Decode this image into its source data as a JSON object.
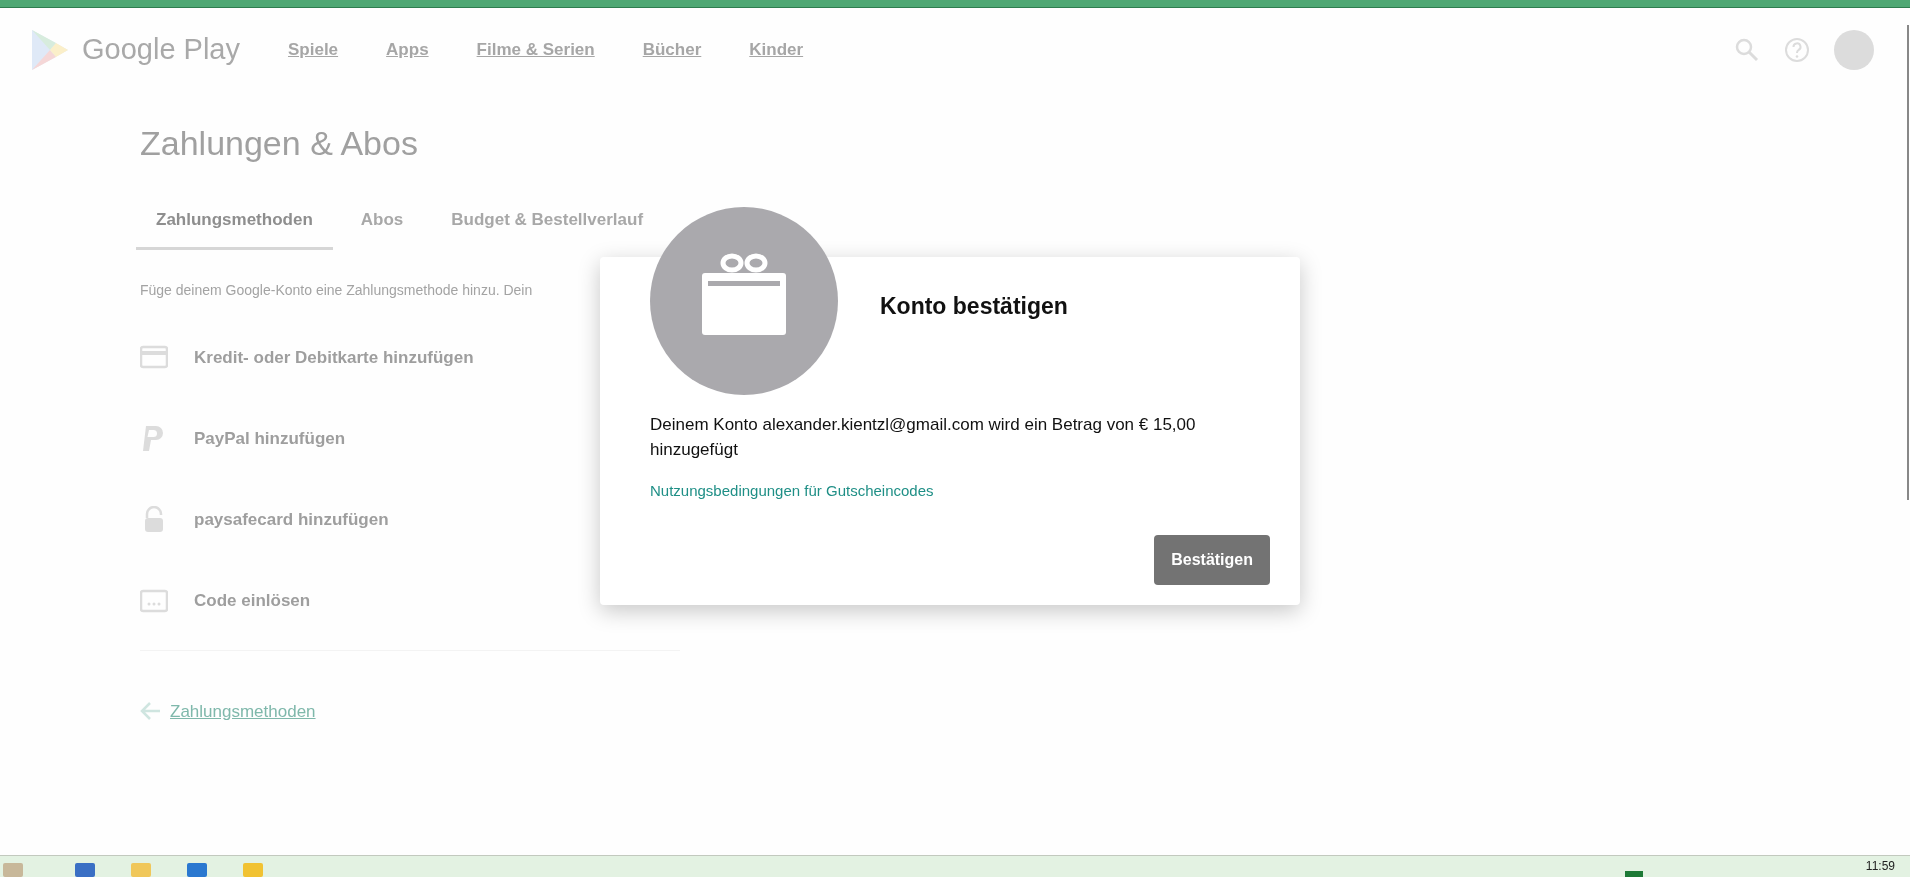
{
  "header": {
    "logo_text": "Google Play",
    "nav": [
      {
        "label": "Spiele"
      },
      {
        "label": "Apps"
      },
      {
        "label": "Filme & Serien"
      },
      {
        "label": "Bücher"
      },
      {
        "label": "Kinder"
      }
    ]
  },
  "page_title": "Zahlungen & Abos",
  "tabs": [
    {
      "label": "Zahlungsmethoden",
      "selected": true
    },
    {
      "label": "Abos",
      "selected": false
    },
    {
      "label": "Budget & Bestellverlauf",
      "selected": false
    }
  ],
  "description": "Füge deinem Google-Konto eine Zahlungsmethode hinzu. Dein",
  "methods": [
    {
      "kind": "card",
      "label": "Kredit- oder Debitkarte hinzufügen"
    },
    {
      "kind": "paypal",
      "label": "PayPal hinzufügen"
    },
    {
      "kind": "lock",
      "label": "paysafecard hinzufügen"
    },
    {
      "kind": "code",
      "label": "Code einlösen"
    }
  ],
  "back_link": "Zahlungsmethoden",
  "dialog": {
    "title": "Konto bestätigen",
    "message": "Deinem Konto alexander.kientzl@gmail.com wird ein Betrag von € 15,00 hinzugefügt",
    "link": "Nutzungsbedingungen für Gutscheincodes",
    "button": "Bestätigen"
  },
  "taskbar": {
    "clock": "11:59"
  }
}
